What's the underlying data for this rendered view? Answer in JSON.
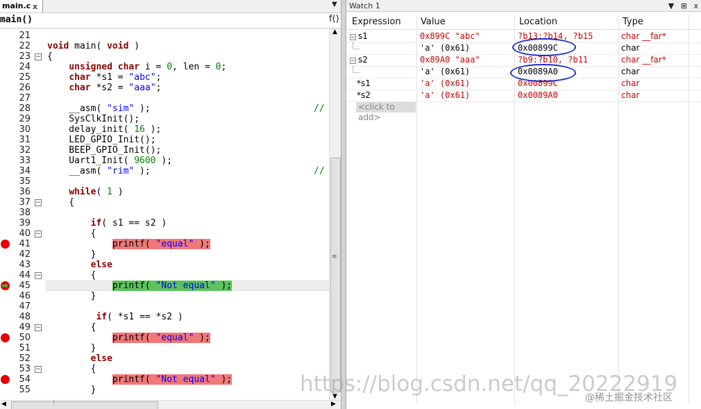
{
  "editor": {
    "tab_label": "main.c",
    "tab_close": "x",
    "dropdown": "▼",
    "function_select": "main()",
    "function_icon": "f()",
    "lines": [
      {
        "n": "21",
        "code": ""
      },
      {
        "n": "22",
        "code": "void main( void )"
      },
      {
        "n": "23",
        "code": "{"
      },
      {
        "n": "24",
        "code": "    unsigned char i = 0, len = 0;"
      },
      {
        "n": "25",
        "code": "    char *s1 = \"abc\";"
      },
      {
        "n": "26",
        "code": "    char *s2 = \"aaa\";"
      },
      {
        "n": "27",
        "code": ""
      },
      {
        "n": "28",
        "code": "    __asm( \"sim\" );"
      },
      {
        "n": "29",
        "code": "    SysClkInit();"
      },
      {
        "n": "30",
        "code": "    delay_init( 16 );"
      },
      {
        "n": "31",
        "code": "    LED_GPIO_Init();"
      },
      {
        "n": "32",
        "code": "    BEEP_GPIO_Init();"
      },
      {
        "n": "33",
        "code": "    Uart1_Init( 9600 );"
      },
      {
        "n": "34",
        "code": "    __asm( \"rim\" );"
      },
      {
        "n": "35",
        "code": ""
      },
      {
        "n": "36",
        "code": "    while( 1 )"
      },
      {
        "n": "37",
        "code": "    {"
      },
      {
        "n": "38",
        "code": ""
      },
      {
        "n": "39",
        "code": "        if( s1 == s2 )"
      },
      {
        "n": "40",
        "code": "        {"
      },
      {
        "n": "41",
        "code": "            printf( \"equal\" );"
      },
      {
        "n": "42",
        "code": "        }"
      },
      {
        "n": "43",
        "code": "        else"
      },
      {
        "n": "44",
        "code": "        {"
      },
      {
        "n": "45",
        "code": "            printf( \"Not equal\" );"
      },
      {
        "n": "46",
        "code": "        }"
      },
      {
        "n": "47",
        "code": ""
      },
      {
        "n": "48",
        "code": "         if( *s1 == *s2 )"
      },
      {
        "n": "49",
        "code": "        {"
      },
      {
        "n": "50",
        "code": "            printf( \"equal\" );"
      },
      {
        "n": "51",
        "code": "        }"
      },
      {
        "n": "52",
        "code": "        else"
      },
      {
        "n": "53",
        "code": "        {"
      },
      {
        "n": "54",
        "code": "            printf( \"Not equal\" );"
      },
      {
        "n": "55",
        "code": "        }"
      }
    ],
    "comment_fragment": "//"
  },
  "watch": {
    "title": "Watch 1",
    "title_buttons": [
      "▼",
      "⊞",
      "x"
    ],
    "columns": [
      "Expression",
      "Value",
      "Location",
      "Type"
    ],
    "rows": [
      {
        "expr": "s1",
        "value": "0x899C \"abc\"",
        "location": "?b13:?b14, ?b15",
        "type": "char __far*",
        "color": "red",
        "expander": "-"
      },
      {
        "expr": "",
        "value": "'a' (0x61)",
        "location": "0x00899C",
        "type": "char",
        "color": "black",
        "expander": ""
      },
      {
        "expr": "s2",
        "value": "0x89A0 \"aaa\"",
        "location": "?b9:?b10, ?b11",
        "type": "char __far*",
        "color": "red",
        "expander": "-"
      },
      {
        "expr": "",
        "value": "'a' (0x61)",
        "location": "0x0089A0",
        "type": "char",
        "color": "black",
        "expander": ""
      },
      {
        "expr": "*s1",
        "value": "'a' (0x61)",
        "location": "0x00899C",
        "type": "char",
        "color": "red",
        "expander": ""
      },
      {
        "expr": "*s2",
        "value": "'a' (0x61)",
        "location": "0x0089A0",
        "type": "char",
        "color": "red",
        "expander": ""
      }
    ],
    "click_to_add": "<click to add>"
  },
  "watermark": "https://blog.csdn.net/qq_20222919",
  "watermark_credit": "@稀土掘金技术社区",
  "colors": {
    "breakpoint": "#e60000",
    "current_line": "#5cc35c",
    "bp_highlight": "#f07878",
    "annotation_circle": "#1a2fd1"
  }
}
